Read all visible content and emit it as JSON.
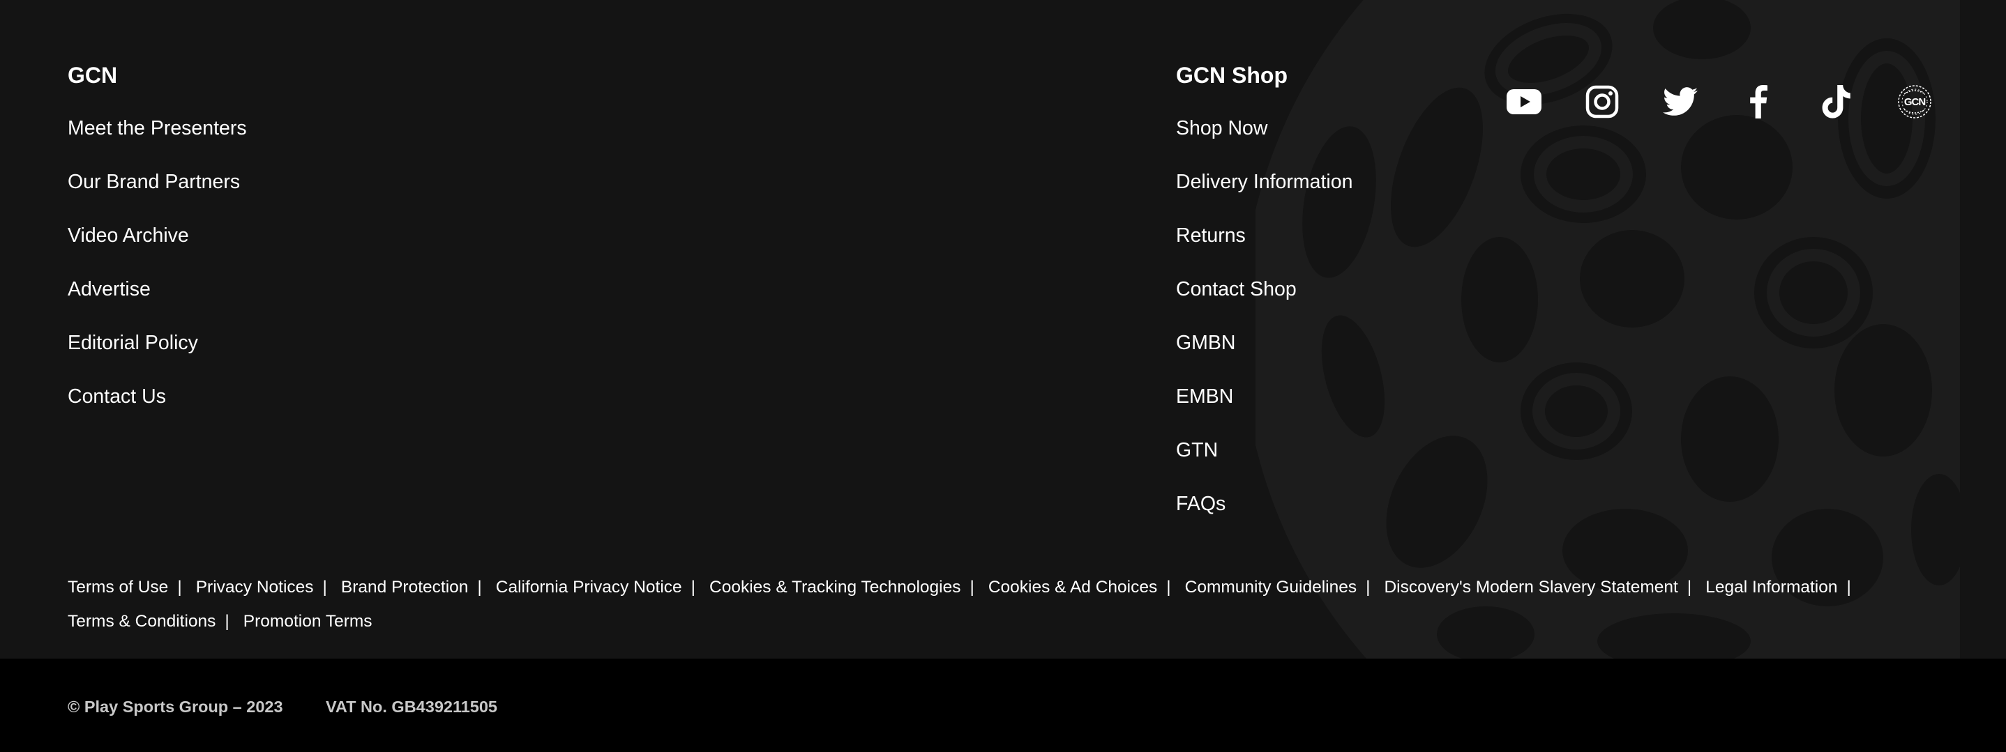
{
  "gcn_column": {
    "heading": "GCN",
    "links": [
      {
        "label": "Meet the Presenters"
      },
      {
        "label": "Our Brand Partners"
      },
      {
        "label": "Video Archive"
      },
      {
        "label": "Advertise"
      },
      {
        "label": "Editorial Policy"
      },
      {
        "label": "Contact Us"
      }
    ]
  },
  "shop_column": {
    "heading": "GCN Shop",
    "links": [
      {
        "label": "Shop Now"
      },
      {
        "label": "Delivery Information"
      },
      {
        "label": "Returns"
      },
      {
        "label": "Contact Shop"
      },
      {
        "label": "GMBN"
      },
      {
        "label": "EMBN"
      },
      {
        "label": "GTN"
      },
      {
        "label": "FAQs"
      }
    ]
  },
  "social": [
    {
      "icon": "youtube-icon"
    },
    {
      "icon": "instagram-icon"
    },
    {
      "icon": "twitter-icon"
    },
    {
      "icon": "facebook-icon"
    },
    {
      "icon": "tiktok-icon"
    },
    {
      "icon": "gcn-globe-icon"
    }
  ],
  "legal_links": [
    {
      "label": "Terms of Use"
    },
    {
      "label": "Privacy Notices"
    },
    {
      "label": "Brand Protection"
    },
    {
      "label": "California Privacy Notice"
    },
    {
      "label": "Cookies & Tracking Technologies"
    },
    {
      "label": "Cookies & Ad Choices"
    },
    {
      "label": "Community Guidelines"
    },
    {
      "label": "Discovery's Modern Slavery Statement"
    },
    {
      "label": "Legal Information"
    },
    {
      "label": "Terms & Conditions"
    },
    {
      "label": "Promotion Terms"
    }
  ],
  "bottom_bar": {
    "copyright": "© Play Sports Group – 2023",
    "vat": "VAT No. GB439211505"
  },
  "colors": {
    "footer_bg": "#141414",
    "bottom_bg": "#000000",
    "text": "#ffffff",
    "muted_text": "#c8c8c8"
  }
}
